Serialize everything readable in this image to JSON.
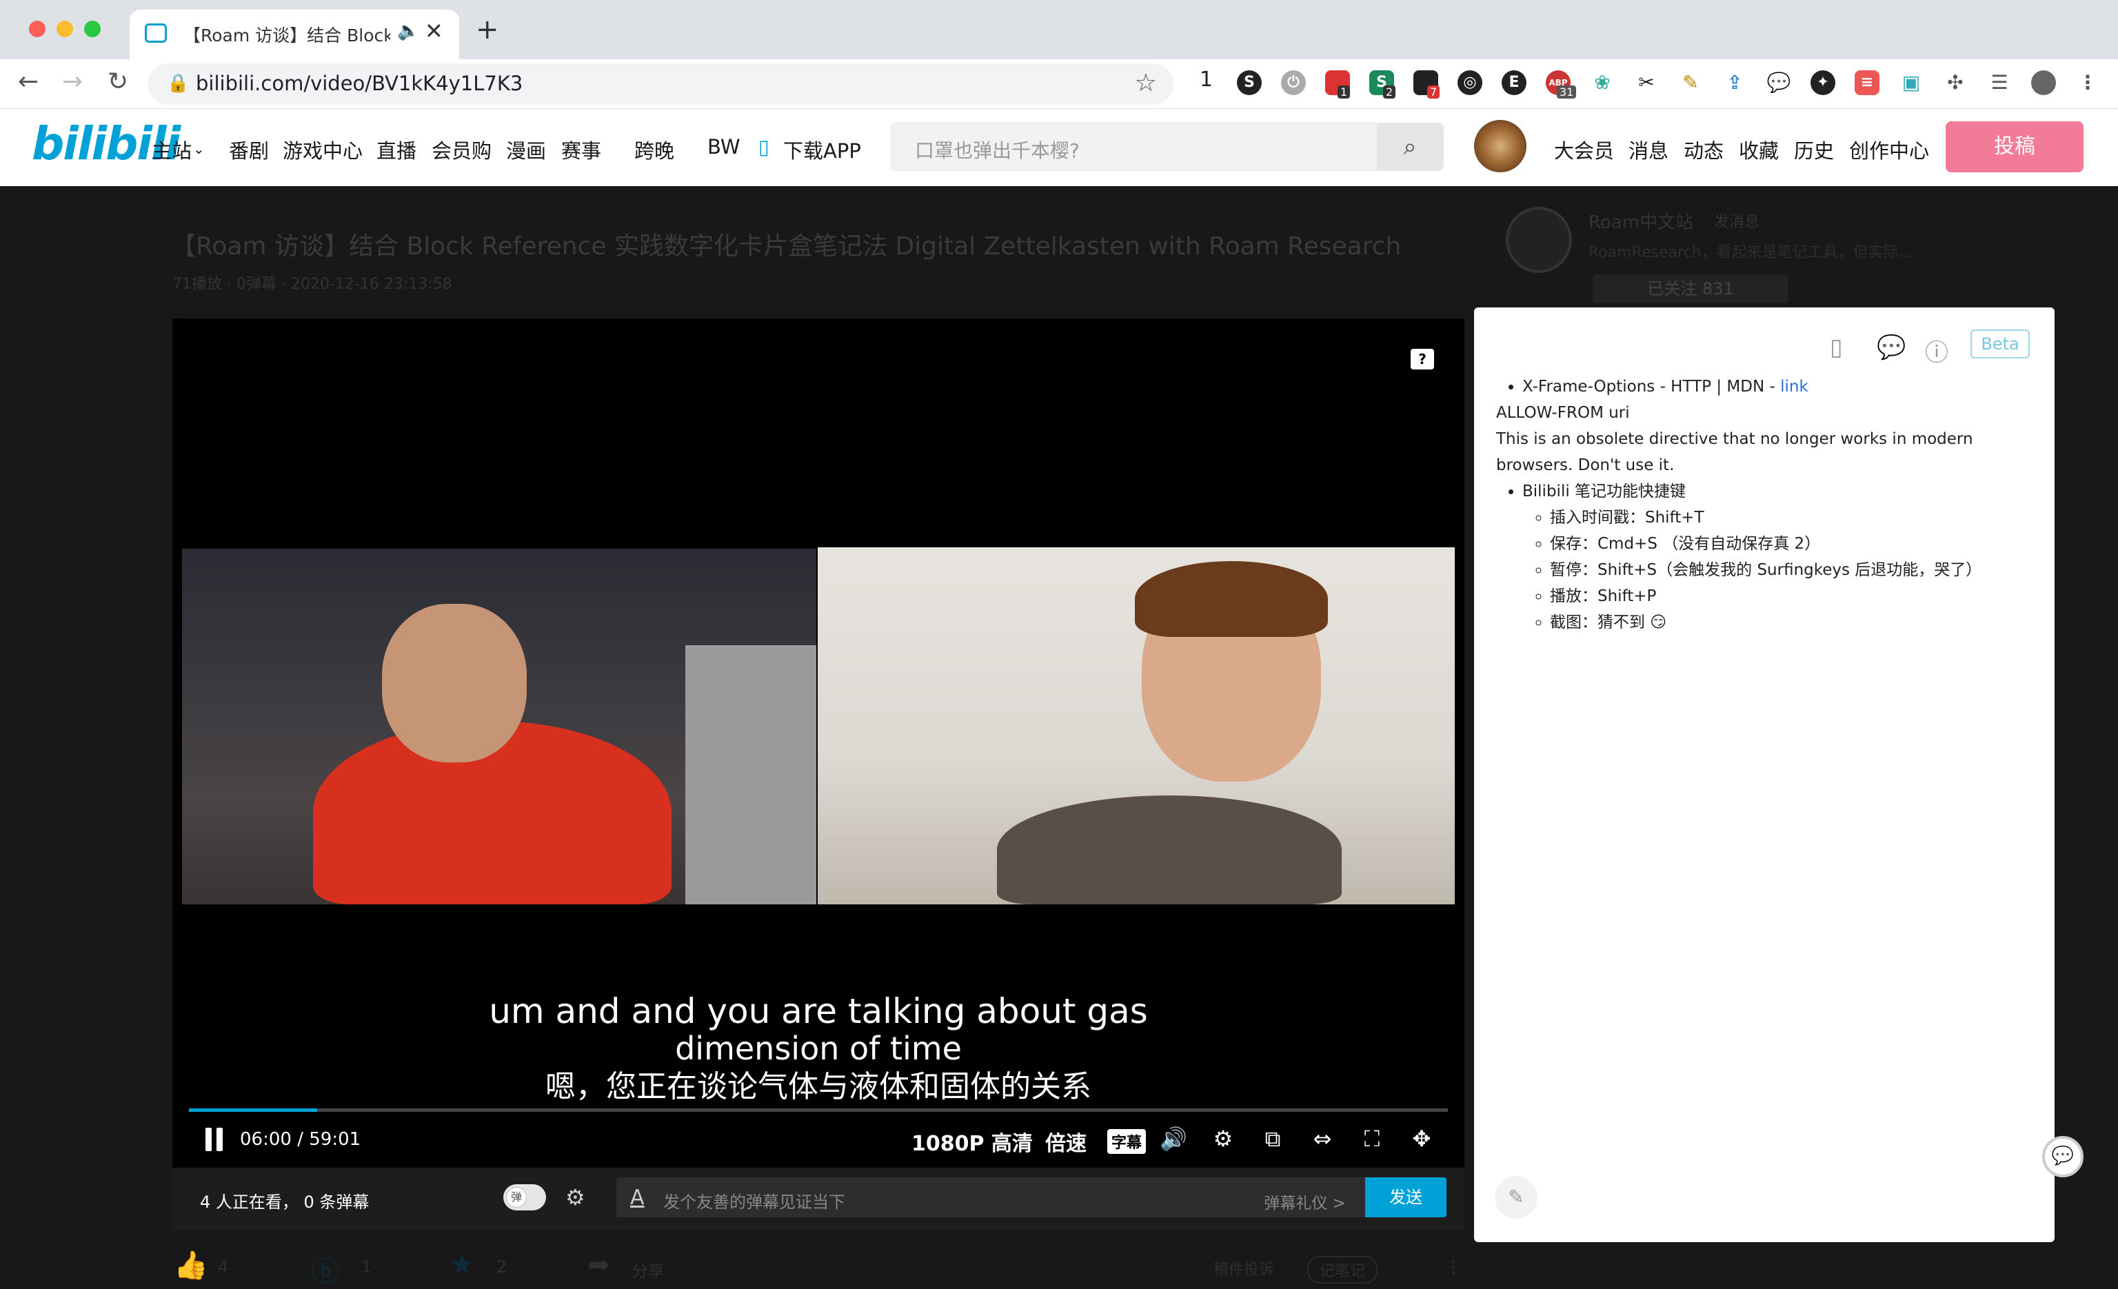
{
  "browser": {
    "tab_title": "【Roam 访谈】结合 Block R",
    "url": "bilibili.com/video/BV1kK4y1L7K3",
    "ext_badges": [
      "1",
      "2",
      "7",
      "31"
    ],
    "ext_count_text": "1"
  },
  "site": {
    "logo": "bilibili",
    "nav": [
      "主站",
      "番剧",
      "游戏中心",
      "直播",
      "会员购",
      "漫画",
      "赛事",
      "跨晚",
      "BW",
      "下载APP"
    ],
    "search_placeholder": "口罩也弹出千本樱?",
    "user_nav": [
      "大会员",
      "消息",
      "动态",
      "收藏",
      "历史",
      "创作中心"
    ],
    "upload_label": "投稿"
  },
  "video": {
    "title": "【Roam 访谈】结合 Block Reference 实践数字化卡片盒笔记法 Digital Zettelkasten with Roam Research",
    "meta": "71播放 · 0弹幕 · 2020-12-16 23:13:58",
    "uploader": "Roam中文站",
    "message_label": "发消息",
    "uploader_desc": "RoamResearch，看起来是笔记工具，但实际…",
    "follow_label": "已关注 831"
  },
  "player": {
    "subtitle_en": "um and and you are talking about gas",
    "subtitle_en2": "dimension of time",
    "subtitle_zh": "嗯，您正在谈论气体与液体和固体的关系",
    "current_time": "06:00",
    "duration": "59:01",
    "progress": 0.102,
    "quality": "1080P 高清",
    "speed": "倍速",
    "subtitle_btn": "字幕"
  },
  "danmaku": {
    "viewers": "4 人正在看， 0 条弹幕",
    "toggle_label": "弹",
    "placeholder": "发个友善的弹幕见证当下",
    "gift": "弹幕礼仪 >",
    "send": "发送"
  },
  "actions": {
    "like": "4",
    "coin": "1",
    "fav": "2",
    "share": "分享",
    "report": "稿件投诉",
    "note": "记笔记"
  },
  "notes": {
    "beta": "Beta",
    "item1": "X-Frame-Options - HTTP | MDN - ",
    "item1_link": "link",
    "para1": "ALLOW-FROM uri",
    "para2": "This is an obsolete directive that no longer works in modern browsers. Don't use it.",
    "item2": "Bilibili 笔记功能快捷键",
    "sub": [
      "插入时间戳：Shift+T",
      "保存：Cmd+S （没有自动保存真 2）",
      "暂停：Shift+S（会触发我的 Surfingkeys 后退功能，哭了）",
      "播放：Shift+P",
      "截图：猜不到 😏"
    ]
  }
}
